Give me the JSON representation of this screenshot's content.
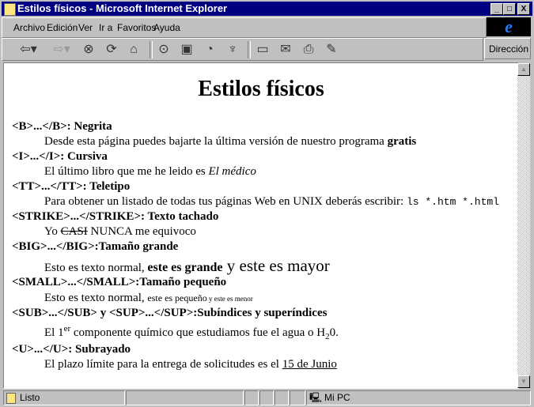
{
  "window": {
    "title": "Estilos físicos - Microsoft Internet Explorer",
    "minimize": "_",
    "maximize": "□",
    "close": "X"
  },
  "menu": [
    "Archivo",
    "Edición",
    "Ver",
    "Ir a",
    "Favoritos",
    "Ayuda"
  ],
  "toolbar": {
    "icons": [
      "back-icon",
      "forward-icon",
      "stop-icon",
      "refresh-icon",
      "home-icon",
      "search-icon",
      "favorites-icon",
      "history-icon",
      "channels-icon",
      "fullscreen-icon",
      "mail-icon",
      "print-icon",
      "edit-icon"
    ],
    "address_label": "Dirección"
  },
  "page": {
    "title": "Estilos físicos",
    "b_head": "<B>...</B>: Negrita",
    "b_text": "Desde esta página puedes bajarte la última versión de nuestro programa ",
    "b_bold": "gratis",
    "i_head": "<I>...</I>: Cursiva",
    "i_text": "El último libro que me he leido es ",
    "i_ital": "El médico",
    "tt_head": "<TT>...</TT>: Teletipo",
    "tt_text": "Para obtener un listado de todas tus páginas Web en UNIX deberás escribir: ",
    "tt_code": "ls *.htm *.html",
    "s_head": "<STRIKE>...</STRIKE>: Texto tachado",
    "s_a": "Yo ",
    "s_strike": "CASI",
    "s_b": " NUNCA me equivoco",
    "big_head": "<BIG>...</BIG>:Tamaño grande",
    "big_a": "Esto es texto normal, ",
    "big_b": "este es grande",
    "big_c": " y este es mayor",
    "small_head": "<SMALL>...</SMALL>:Tamaño pequeño",
    "small_a": "Esto es texto normal, ",
    "small_b": "este es pequeño",
    "small_c": " y este es menor",
    "sub_head": "<SUB>...</SUB> y <SUP>...</SUP>:Subíndices y superíndices",
    "sub_a": "El 1",
    "sub_sup": "er",
    "sub_b": " componente químico que estudiamos fue el agua o H",
    "sub_sub": "2",
    "sub_c": "0.",
    "u_head": "<U>...</U>: Subrayado",
    "u_text": "El plazo límite para la entrega de solicitudes es el ",
    "u_under": "15 de Junio"
  },
  "status": {
    "text": "Listo",
    "zone": "Mi PC"
  }
}
